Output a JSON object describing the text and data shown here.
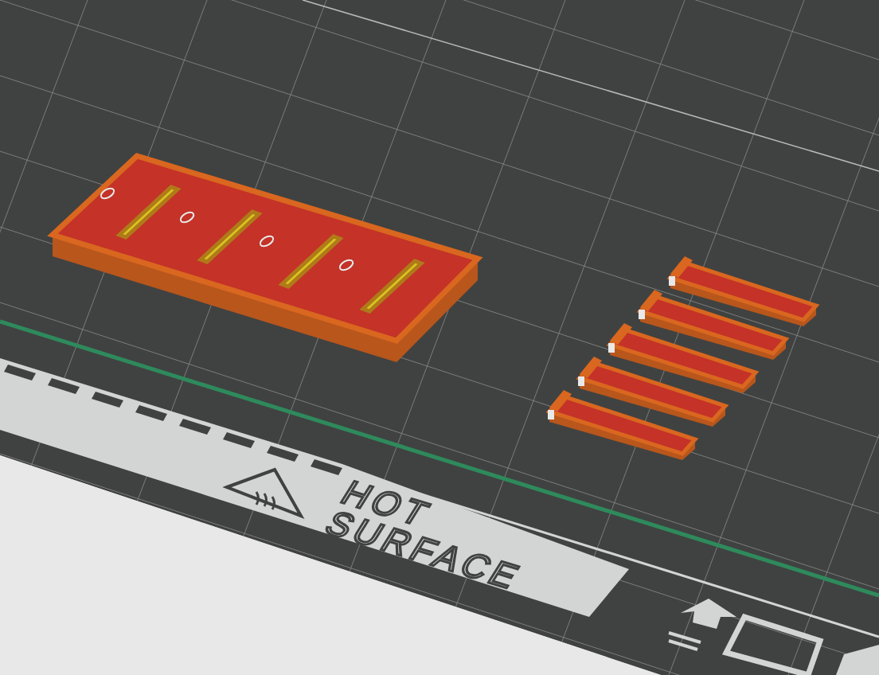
{
  "viewport": {
    "bed_label": [
      "HOT",
      "SURFACE"
    ],
    "objects": [
      {
        "kind": "tray"
      },
      {
        "kind": "bar"
      },
      {
        "kind": "bar"
      },
      {
        "kind": "bar"
      },
      {
        "kind": "bar"
      },
      {
        "kind": "bar"
      }
    ]
  }
}
